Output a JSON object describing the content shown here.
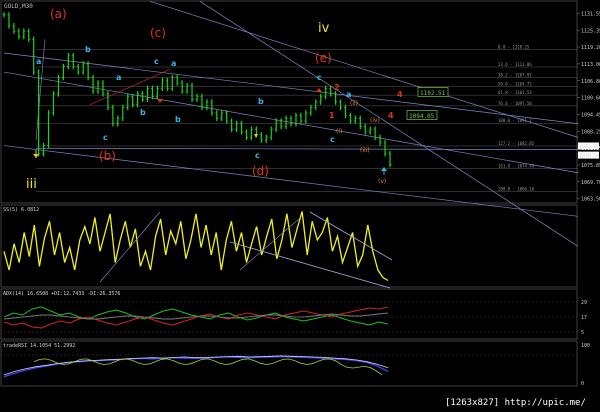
{
  "chart_title": "GOLD,M30",
  "watermark": "[1263x827] http://upic.me/",
  "chart_data": [
    {
      "type": "line",
      "title": "GOLD,M30",
      "series": [],
      "close": [
        1131,
        1127,
        1125,
        1123,
        1125,
        1122,
        1110,
        1080,
        1083,
        1095,
        1102,
        1108,
        1112,
        1116,
        1112,
        1110,
        1113,
        1108,
        1103,
        1106,
        1102,
        1097,
        1091,
        1093,
        1097,
        1101,
        1098,
        1102,
        1100,
        1104,
        1101,
        1104,
        1107,
        1104,
        1108,
        1106,
        1103,
        1105,
        1100,
        1101,
        1097,
        1099,
        1095,
        1093,
        1095,
        1092,
        1089,
        1091,
        1088,
        1086,
        1089,
        1087,
        1085,
        1086,
        1089,
        1092,
        1090,
        1093,
        1091,
        1094,
        1092,
        1095,
        1097,
        1099,
        1101,
        1104,
        1102,
        1099,
        1097,
        1094,
        1092,
        1093,
        1090,
        1088,
        1089,
        1086,
        1084,
        1080,
        1076
      ],
      "ylim": [
        1063,
        1135
      ],
      "y_ticks": [
        1131.55,
        1125.35,
        1119.2,
        1113.0,
        1106.8,
        1100.6,
        1094.45,
        1088.25,
        1082.05,
        1075.85,
        1069.7,
        1063.5
      ],
      "current_price_tag": "1079.31",
      "current_price_tag_prev": "1082.65",
      "level_boxes": [
        {
          "label": "1102.51",
          "value": 1102.51
        },
        {
          "label": "1094.05",
          "value": 1094.05
        }
      ],
      "fib_levels": [
        {
          "label": "0.0 - 1118.25",
          "value": 1118.25
        },
        {
          "label": "23.6 - 1111.86",
          "value": 1111.86
        },
        {
          "label": "38.2 - 1107.91",
          "value": 1107.91
        },
        {
          "label": "50.0 - 1104.72",
          "value": 1104.72
        },
        {
          "label": "61.8 - 1101.53",
          "value": 1101.53
        },
        {
          "label": "76.4 - 1097.58",
          "value": 1097.58
        },
        {
          "label": "100.0 - 1091.2",
          "value": 1091.2
        },
        {
          "label": "127.2 - 1082.85",
          "value": 1082.85
        },
        {
          "label": "161.8 - 1074.49",
          "value": 1074.49
        },
        {
          "label": "200.0 - 1066.16",
          "value": 1066.16
        }
      ],
      "annotations": {
        "red": [
          "(a)",
          "(b)",
          "(c)",
          "(d)",
          "(e)",
          "2",
          "4",
          "4",
          "1"
        ],
        "yellow": [
          "iv",
          "iii"
        ],
        "blue": [
          "a",
          "b",
          "c",
          "a",
          "b",
          "c",
          "a",
          "b",
          "c",
          "b",
          "c",
          "a",
          "c"
        ],
        "orange": [
          "(ii)",
          "(i)",
          "(iv)",
          "(iii)",
          "(v)"
        ]
      }
    },
    {
      "type": "line",
      "title": "SS(5) 6.0812",
      "ylim": [
        0,
        100
      ],
      "values": [
        45,
        20,
        55,
        30,
        70,
        38,
        80,
        25,
        62,
        85,
        40,
        70,
        30,
        50,
        20,
        60,
        78,
        55,
        90,
        45,
        70,
        95,
        30,
        60,
        85,
        50,
        75,
        25,
        45,
        20,
        65,
        88,
        40,
        72,
        55,
        85,
        35,
        60,
        95,
        50,
        80,
        40,
        70,
        20,
        60,
        85,
        45,
        70,
        30,
        55,
        78,
        40,
        65,
        88,
        35,
        60,
        95,
        50,
        75,
        98,
        40,
        85,
        60,
        70,
        90,
        45,
        65,
        30,
        50,
        70,
        25,
        40,
        80,
        45,
        20,
        10,
        6
      ]
    },
    {
      "type": "line",
      "title": "ADX(14) 16.6508 +DI:12.7433 -DI:26.3576",
      "ylim": [
        0,
        40
      ],
      "y_ticks": [
        "29",
        "17",
        "5"
      ],
      "series": [
        {
          "name": "+DI",
          "values": [
            20,
            24,
            22,
            28,
            30,
            26,
            22,
            24,
            20,
            18,
            22,
            25,
            27,
            24,
            20,
            18,
            22,
            26,
            28,
            25,
            22,
            20,
            18,
            22,
            24,
            20,
            17,
            19,
            22,
            24,
            20,
            18,
            16,
            18,
            20,
            22,
            19,
            16,
            14,
            12,
            15,
            13
          ]
        },
        {
          "name": "-DI",
          "values": [
            15,
            12,
            14,
            10,
            9,
            13,
            16,
            14,
            18,
            20,
            17,
            14,
            12,
            15,
            18,
            20,
            17,
            14,
            12,
            15,
            18,
            21,
            23,
            20,
            18,
            22,
            24,
            22,
            20,
            18,
            22,
            24,
            26,
            24,
            22,
            20,
            23,
            25,
            27,
            29,
            28,
            30
          ]
        },
        {
          "name": "ADX",
          "values": [
            18,
            19,
            20,
            21,
            22,
            22,
            21,
            20,
            19,
            18,
            18,
            19,
            20,
            21,
            21,
            20,
            19,
            18,
            18,
            19,
            20,
            21,
            21,
            20,
            19,
            19,
            20,
            21,
            22,
            22,
            21,
            20,
            20,
            21,
            22,
            23,
            22,
            21,
            21,
            22,
            23,
            24
          ]
        }
      ]
    },
    {
      "type": "line",
      "title": "tradeRSI 14.1054 51.2992",
      "ylim": [
        0,
        100
      ],
      "y_ticks": [
        "100",
        "0"
      ],
      "series": [
        {
          "name": "",
          "values": [
            20,
            30,
            38,
            45,
            50,
            55,
            60,
            62,
            64,
            65,
            66,
            68,
            70,
            71,
            70,
            72,
            73,
            72,
            71,
            72,
            74,
            75,
            74,
            73,
            74,
            75,
            76,
            75,
            74,
            73,
            72,
            70,
            68,
            65,
            60,
            50,
            35
          ]
        },
        {
          "name": "",
          "values": [
            25,
            35,
            42,
            48,
            52,
            57,
            60,
            63,
            65,
            66,
            68,
            69,
            71,
            72,
            73,
            72,
            74,
            75,
            73,
            74,
            75,
            76,
            77,
            75,
            76,
            77,
            78,
            77,
            76,
            75,
            74,
            72,
            70,
            67,
            62,
            55,
            45
          ]
        }
      ]
    }
  ]
}
